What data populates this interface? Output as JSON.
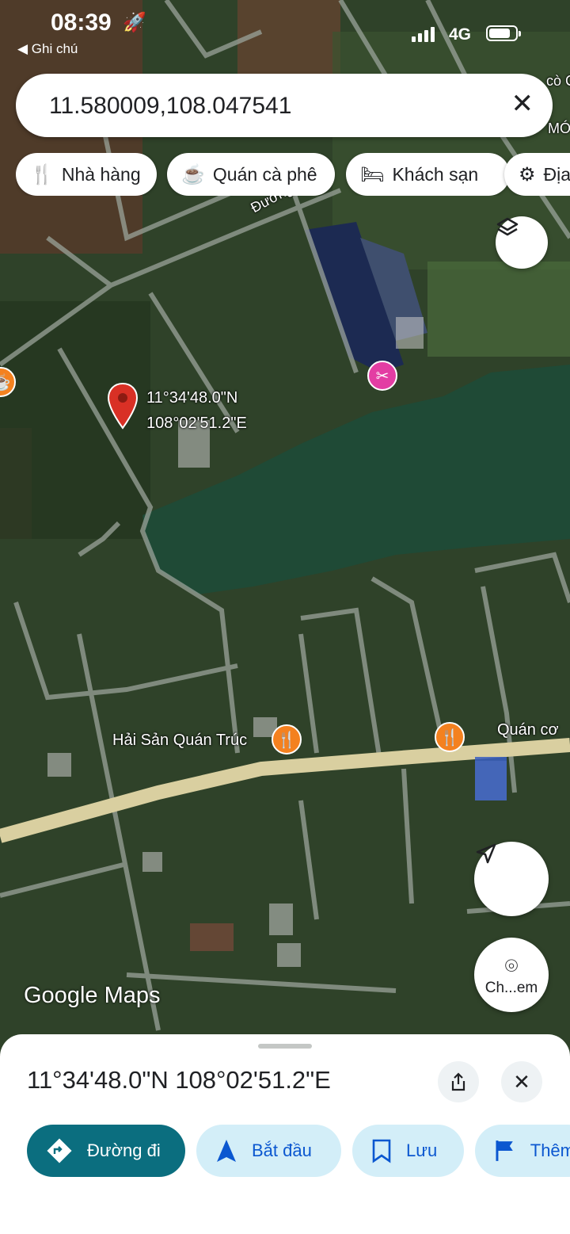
{
  "status_bar": {
    "time": "08:39",
    "back_label": "◀ Ghi chú",
    "network": "4G"
  },
  "search": {
    "value": "11.580009,108.047541"
  },
  "chips": [
    {
      "label": "Nhà hàng",
      "icon": "fork-knife-icon"
    },
    {
      "label": "Quán cà phê",
      "icon": "coffee-cup-icon"
    },
    {
      "label": "Khách sạn",
      "icon": "bed-icon"
    },
    {
      "label": "Địa",
      "icon": "landmark-icon"
    }
  ],
  "map": {
    "pin_label_line1": "11°34'48.0\"N",
    "pin_label_line2": "108°02'51.2\"E",
    "road_label": "Đường",
    "place_restaurant_1": "Hải Sản Quán Trúc",
    "place_restaurant_2": "Quán cơ",
    "corner_label_1": "cò C",
    "corner_label_2": "MÓ",
    "watermark": "Google Maps",
    "camera_button_label": "Ch...em"
  },
  "sheet": {
    "coordinates": "11°34'48.0\"N 108°02'51.2\"E",
    "actions": [
      {
        "label": "Đường đi",
        "icon": "directions-icon"
      },
      {
        "label": "Bắt đầu",
        "icon": "navigation-icon"
      },
      {
        "label": "Lưu",
        "icon": "bookmark-icon"
      },
      {
        "label": "Thêm",
        "icon": "flag-icon"
      }
    ]
  },
  "colors": {
    "primary_action": "#0b6e7f",
    "secondary_action": "#d3eef8",
    "pin": "#d93025",
    "restaurant_poi": "#f4811f",
    "shop_poi": "#e33da3"
  }
}
